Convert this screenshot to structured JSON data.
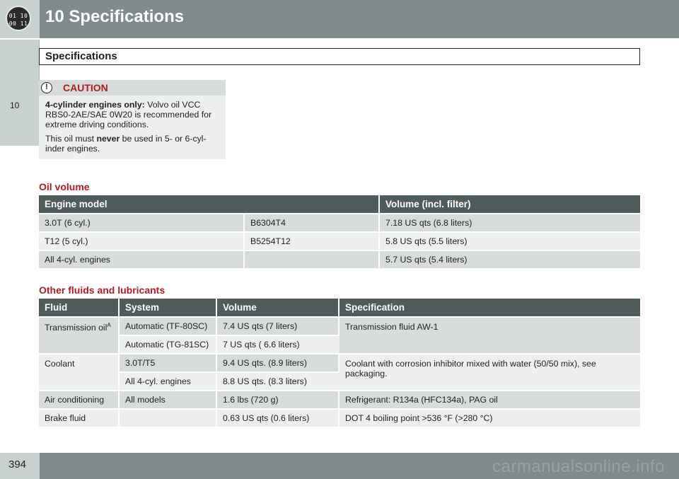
{
  "header": {
    "badge_top": "01 10",
    "badge_bottom": "00 11",
    "chapter_title": "10 Specifications"
  },
  "side_tab": {
    "label": "10"
  },
  "section": {
    "title": "Specifications"
  },
  "caution": {
    "title": "CAUTION",
    "p1_bold": "4-cylinder engines only:",
    "p1_rest": " Volvo oil VCC RBS0-2AE/SAE 0W20 is recommended for extreme driving conditions.",
    "p2_pre": "This oil must ",
    "p2_bold": "never",
    "p2_post": " be used in 5- or 6-cyl- inder engines."
  },
  "oil_volume": {
    "heading": "Oil volume",
    "headers": [
      "Engine model",
      "Volume (incl. filter)"
    ],
    "rows": [
      {
        "model": "3.0T (6 cyl.)",
        "code": "B6304T4",
        "volume": "7.18 US qts (6.8 liters)"
      },
      {
        "model": "T12 (5 cyl.)",
        "code": "B5254T12",
        "volume": "5.8 US qts (5.5 liters)"
      },
      {
        "model": "All 4-cyl. engines",
        "code": "",
        "volume": "5.7 US qts (5.4 liters)"
      }
    ]
  },
  "fluids": {
    "heading": "Other fluids and lubricants",
    "headers": [
      "Fluid",
      "System",
      "Volume",
      "Specification"
    ],
    "transmission": {
      "fluid": "Transmission oil",
      "footnote": "A",
      "spec": "Transmission fluid AW-1",
      "rows": [
        {
          "system": "Automatic (TF-80SC)",
          "volume": "7.4 US qts (7 liters)"
        },
        {
          "system": "Automatic (TG-81SC)",
          "volume": "7 US qts ( 6.6 liters)"
        }
      ]
    },
    "coolant": {
      "fluid": "Coolant",
      "spec": "Coolant with corrosion inhibitor mixed with water (50/50 mix), see packaging.",
      "rows": [
        {
          "system": "3.0T/T5",
          "volume": "9.4 US qts. (8.9 liters)"
        },
        {
          "system": "All 4-cyl. engines",
          "volume": "8.8 US qts. (8.3 liters)"
        }
      ]
    },
    "air_conditioning": {
      "fluid": "Air conditioning",
      "system": "All models",
      "volume": "1.6 lbs (720 g)",
      "spec": "Refrigerant: R134a (HFC134a), PAG oil"
    },
    "brake": {
      "fluid": "Brake fluid",
      "system": "",
      "volume": "0.63 US qts (0.6 liters)",
      "spec": "DOT 4 boiling point >536 °F (>280 °C)"
    }
  },
  "footer": {
    "page_number": "394",
    "watermark": "carmanualsonline.info"
  }
}
